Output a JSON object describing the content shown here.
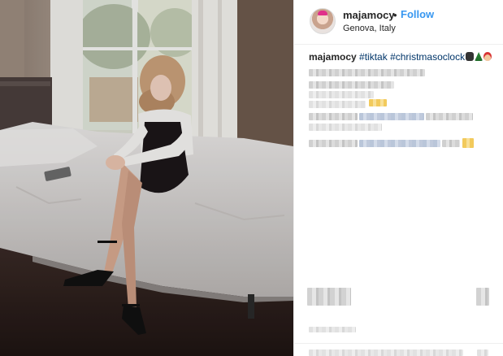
{
  "post": {
    "header": {
      "username": "majamocy",
      "separator": "•",
      "follow_label": "Follow",
      "location": "Genova, Italy"
    },
    "caption": {
      "username": "majamocy",
      "hashtags": [
        "#tiktak",
        "#christmasoclock"
      ],
      "emojis": [
        "watch-emoji",
        "christmas-tree-emoji",
        "santa-emoji"
      ]
    },
    "colors": {
      "follow_blue": "#3897f0",
      "hashtag_navy": "#003569",
      "text": "#262626",
      "divider": "#efefef"
    }
  }
}
